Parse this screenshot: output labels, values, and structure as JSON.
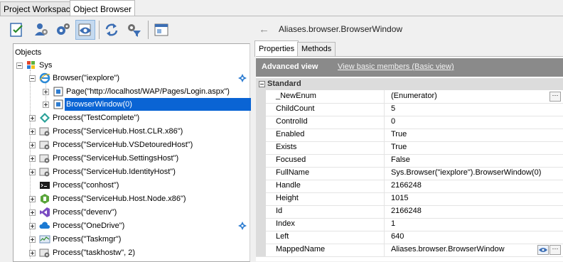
{
  "tabs": [
    {
      "label": "Project Workspace",
      "active": false
    },
    {
      "label": "Object Browser",
      "active": true
    }
  ],
  "toolbar": {
    "icons": [
      "checklist-icon",
      "user-settings-icon",
      "gears-icon",
      "eye-icon",
      "refresh-icon",
      "filter-settings-icon",
      "window-icon"
    ]
  },
  "tree": {
    "nodes": [
      {
        "label": "Objects"
      },
      {
        "label": "Sys"
      },
      {
        "label": "Browser(\"iexplore\")"
      },
      {
        "label": "Page(\"http://localhost/WAP/Pages/Login.aspx\")"
      },
      {
        "label": "BrowserWindow(0)",
        "selected": true
      },
      {
        "label": "Process(\"TestComplete\")"
      },
      {
        "label": "Process(\"ServiceHub.Host.CLR.x86\")"
      },
      {
        "label": "Process(\"ServiceHub.VSDetouredHost\")"
      },
      {
        "label": "Process(\"ServiceHub.SettingsHost\")"
      },
      {
        "label": "Process(\"ServiceHub.IdentityHost\")"
      },
      {
        "label": "Process(\"conhost\")"
      },
      {
        "label": "Process(\"ServiceHub.Host.Node.x86\")"
      },
      {
        "label": "Process(\"devenv\")"
      },
      {
        "label": "Process(\"OneDrive\")"
      },
      {
        "label": "Process(\"Taskmgr\")"
      },
      {
        "label": "Process(\"taskhostw\", 2)"
      }
    ]
  },
  "details": {
    "title": "Aliases.browser.BrowserWindow",
    "tabs": [
      "Properties",
      "Methods"
    ],
    "advanced_view_label": "Advanced view",
    "basic_view_link": "View basic members (Basic view)",
    "category": "Standard",
    "properties": [
      {
        "name": "_NewEnum",
        "value": "(Enumerator)"
      },
      {
        "name": "ChildCount",
        "value": "5"
      },
      {
        "name": "ControlId",
        "value": "0"
      },
      {
        "name": "Enabled",
        "value": "True"
      },
      {
        "name": "Exists",
        "value": "True"
      },
      {
        "name": "Focused",
        "value": "False"
      },
      {
        "name": "FullName",
        "value": "Sys.Browser(\"iexplore\").BrowserWindow(0)"
      },
      {
        "name": "Handle",
        "value": "2166248"
      },
      {
        "name": "Height",
        "value": "1015"
      },
      {
        "name": "Id",
        "value": "2166248"
      },
      {
        "name": "Index",
        "value": "1"
      },
      {
        "name": "Left",
        "value": "640"
      },
      {
        "name": "MappedName",
        "value": "Aliases.browser.BrowserWindow"
      }
    ]
  },
  "colors": {
    "selection": "#0a64d4",
    "header_bar": "#8a8a8a",
    "accent_blue": "#1f6fc5"
  }
}
